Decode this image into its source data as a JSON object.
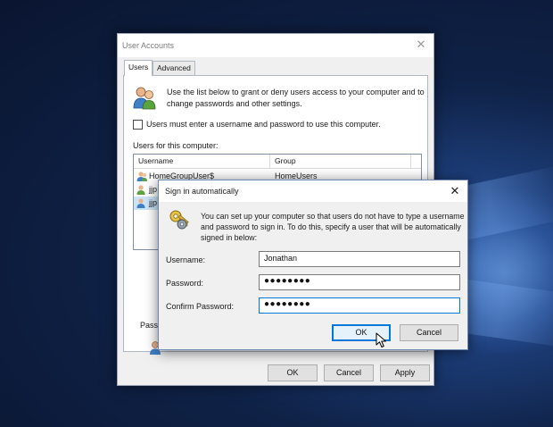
{
  "window": {
    "title": "User Accounts",
    "close_glyph": "✕",
    "tabs": [
      {
        "label": "Users",
        "active": true
      },
      {
        "label": "Advanced",
        "active": false
      }
    ],
    "intro": "Use the list below to grant or deny users access to your computer and to change passwords and other settings.",
    "require_login": {
      "label": "Users must enter a username and password to use this computer.",
      "checked": false
    },
    "list_label": "Users for this computer:",
    "columns": [
      "Username",
      "Group"
    ],
    "rows": [
      {
        "username": "HomeGroupUser$",
        "group": "HomeUsers"
      },
      {
        "username": "jjp",
        "group": ""
      },
      {
        "username": "jjp",
        "group": ""
      }
    ],
    "password_group_label": "Passw",
    "buttons": {
      "ok": "OK",
      "cancel": "Cancel",
      "apply": "Apply"
    }
  },
  "dialog": {
    "title": "Sign in automatically",
    "close_glyph": "✕",
    "intro": "You can set up your computer so that users do not have to type a username and password to sign in. To do this, specify a user that will be automatically signed in below:",
    "username": {
      "label": "Username:",
      "value": "Jonathan"
    },
    "password": {
      "label": "Password:",
      "value": "●●●●●●●●"
    },
    "confirm": {
      "label": "Confirm Password:",
      "value": "●●●●●●●●"
    },
    "buttons": {
      "ok": "OK",
      "cancel": "Cancel"
    }
  },
  "colors": {
    "accent": "#0078d7",
    "selection": "#cce4f7",
    "desktop": "#0f2247"
  },
  "icons": {
    "window_icon": "users-icon",
    "dialog_icon": "keys-icon",
    "cursor": "mouse-pointer-icon"
  }
}
